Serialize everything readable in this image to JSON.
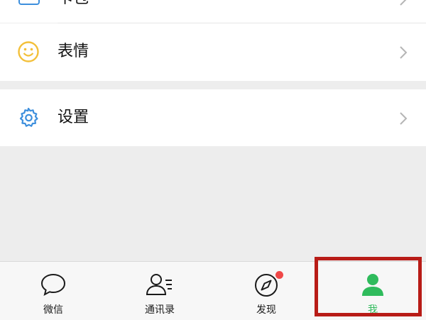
{
  "menu": {
    "top_item": {
      "label": "卡包",
      "icon": "card-wallet-icon"
    },
    "emoji_item": {
      "label": "表情",
      "icon": "smiley-face-icon"
    },
    "settings_item": {
      "label": "设置",
      "icon": "gear-icon"
    }
  },
  "tabbar": {
    "tabs": [
      {
        "label": "微信",
        "icon": "chat-bubble-icon"
      },
      {
        "label": "通讯录",
        "icon": "contacts-icon"
      },
      {
        "label": "发现",
        "icon": "compass-icon",
        "badge": true
      },
      {
        "label": "我",
        "icon": "person-icon",
        "selected": true
      }
    ]
  },
  "colors": {
    "accent_green": "#2fbb5c",
    "badge_red": "#f04848",
    "highlight_red": "#b81c17",
    "emoji_yellow": "#f3c03a",
    "icon_blue": "#3d8fdd"
  }
}
